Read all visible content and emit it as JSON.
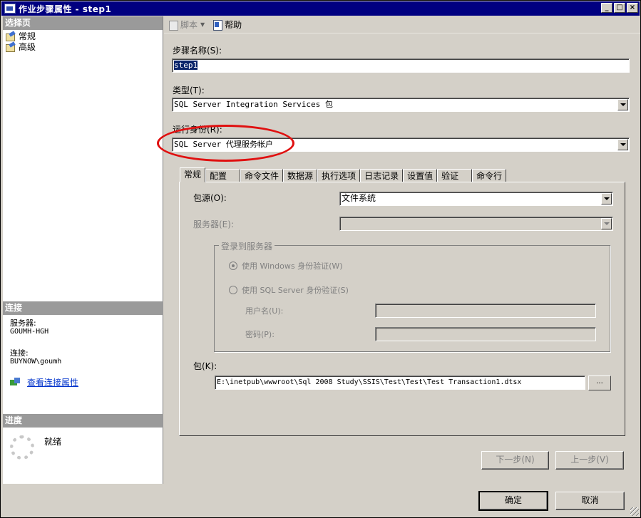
{
  "window": {
    "title": "作业步骤属性 - step1",
    "min_label": "_",
    "max_label": "□",
    "close_label": "×"
  },
  "left_pane": {
    "select_page_header": "选择页",
    "pages": [
      {
        "label": "常规"
      },
      {
        "label": "高级"
      }
    ],
    "connection_header": "连接",
    "server_label": "服务器:",
    "server_value": "GOUMH-HGH",
    "connection_label": "连接:",
    "connection_value": "BUYNOW\\goumh",
    "view_connection_link": "查看连接属性",
    "progress_header": "进度",
    "progress_status": "就绪"
  },
  "toolbar": {
    "script_label": "脚本",
    "script_arrow": "▼",
    "help_label": "帮助"
  },
  "form": {
    "step_name_label": "步骤名称(S):",
    "step_name_value": "step1",
    "type_label": "类型(T):",
    "type_value": "SQL Server Integration Services 包",
    "run_as_label": "运行身份(R):",
    "run_as_value": "SQL Server 代理服务帐户"
  },
  "tabs": [
    {
      "label": "常规",
      "active": true
    },
    {
      "label": "配置"
    },
    {
      "label": "命令文件"
    },
    {
      "label": "数据源"
    },
    {
      "label": "执行选项"
    },
    {
      "label": "日志记录"
    },
    {
      "label": "设置值"
    },
    {
      "label": "验证"
    },
    {
      "label": "命令行"
    }
  ],
  "general_tab": {
    "package_source_label": "包源(O):",
    "package_source_value": "文件系统",
    "server_label": "服务器(E):",
    "server_value": "",
    "login_group_label": "登录到服务器",
    "windows_auth_label": "使用 Windows 身份验证(W)",
    "sql_auth_label": "使用 SQL Server 身份验证(S)",
    "username_label": "用户名(U):",
    "password_label": "密码(P):",
    "package_label": "包(K):",
    "package_value": "E:\\inetpub\\wwwroot\\Sql 2008 Study\\SSIS\\Test\\Test\\Test Transaction1.dtsx",
    "browse_label": "..."
  },
  "nav_buttons": {
    "next_label": "下一步(N)",
    "prev_label": "上一步(V)"
  },
  "footer": {
    "ok_label": "确定",
    "cancel_label": "取消"
  },
  "colors": {
    "title_bar": "#000080",
    "dialog_bg": "#d4d0c8",
    "section_header": "#9a9a9a",
    "annotation_circle": "#e01010",
    "link": "#0033cc"
  }
}
